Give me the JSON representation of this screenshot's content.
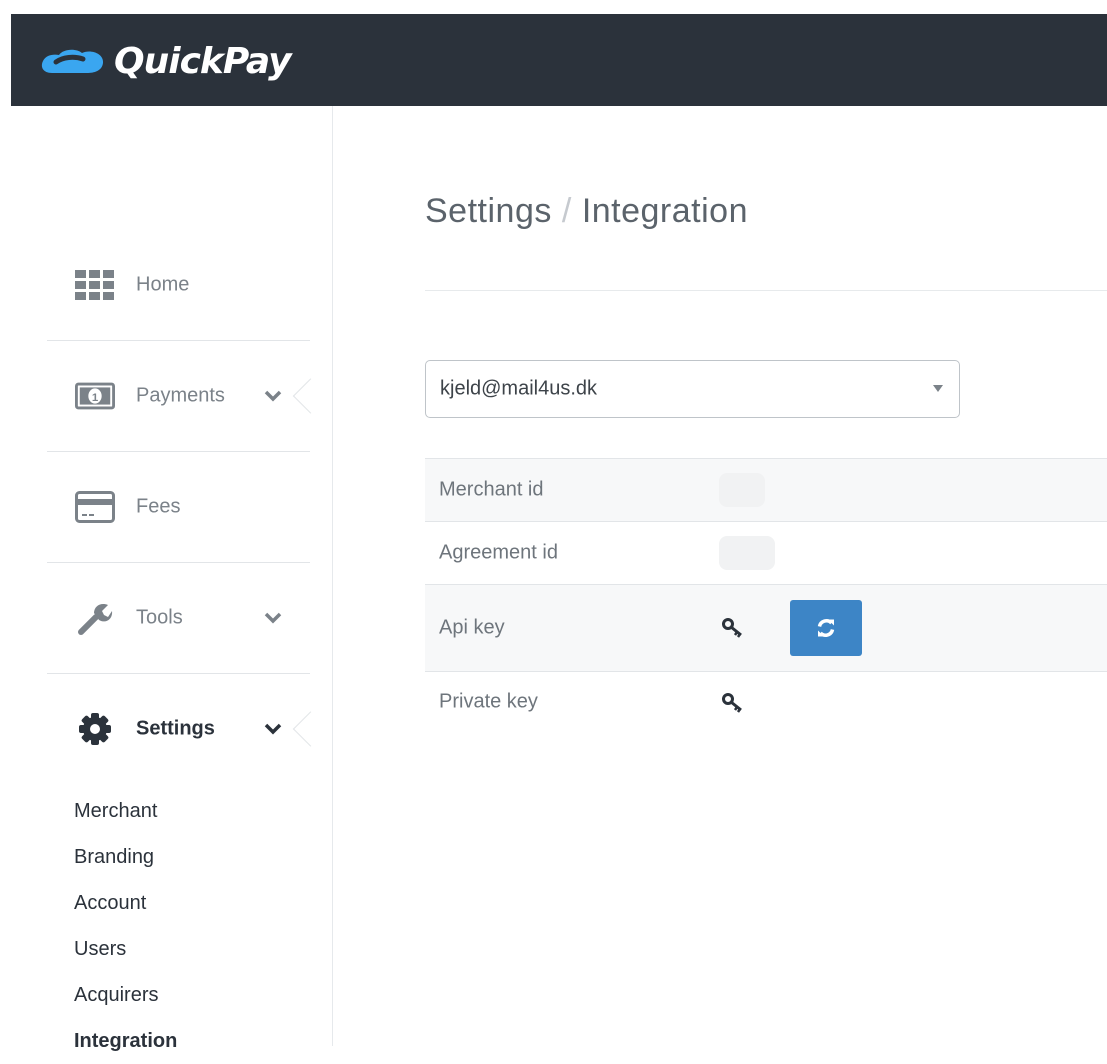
{
  "brand": {
    "name": "QuickPay"
  },
  "colors": {
    "topbar": "#2b323b",
    "accent": "#3d85c6",
    "logo_blue": "#3aa6f0",
    "active_text": "#2b323b",
    "muted_text": "#7b8289"
  },
  "sidebar": {
    "items": [
      {
        "label": "Home",
        "icon": "grid-icon"
      },
      {
        "label": "Payments",
        "icon": "banknote-icon"
      },
      {
        "label": "Fees",
        "icon": "credit-card-icon"
      },
      {
        "label": "Tools",
        "icon": "wrench-icon"
      },
      {
        "label": "Settings",
        "icon": "gear-icon",
        "active": true
      }
    ],
    "settings_submenu": [
      {
        "label": "Merchant"
      },
      {
        "label": "Branding"
      },
      {
        "label": "Account"
      },
      {
        "label": "Users"
      },
      {
        "label": "Acquirers"
      },
      {
        "label": "Integration",
        "active": true
      }
    ]
  },
  "page": {
    "breadcrumb": {
      "parent": "Settings",
      "separator": "/",
      "current": "Integration"
    }
  },
  "user_select": {
    "selected": "kjeld@mail4us.dk"
  },
  "integration_table": {
    "rows": [
      {
        "label": "Merchant id"
      },
      {
        "label": "Agreement id"
      },
      {
        "label": "Api key",
        "icon": "key-icon",
        "action_icon": "refresh-icon"
      },
      {
        "label": "Private key",
        "icon": "key-icon"
      }
    ]
  }
}
